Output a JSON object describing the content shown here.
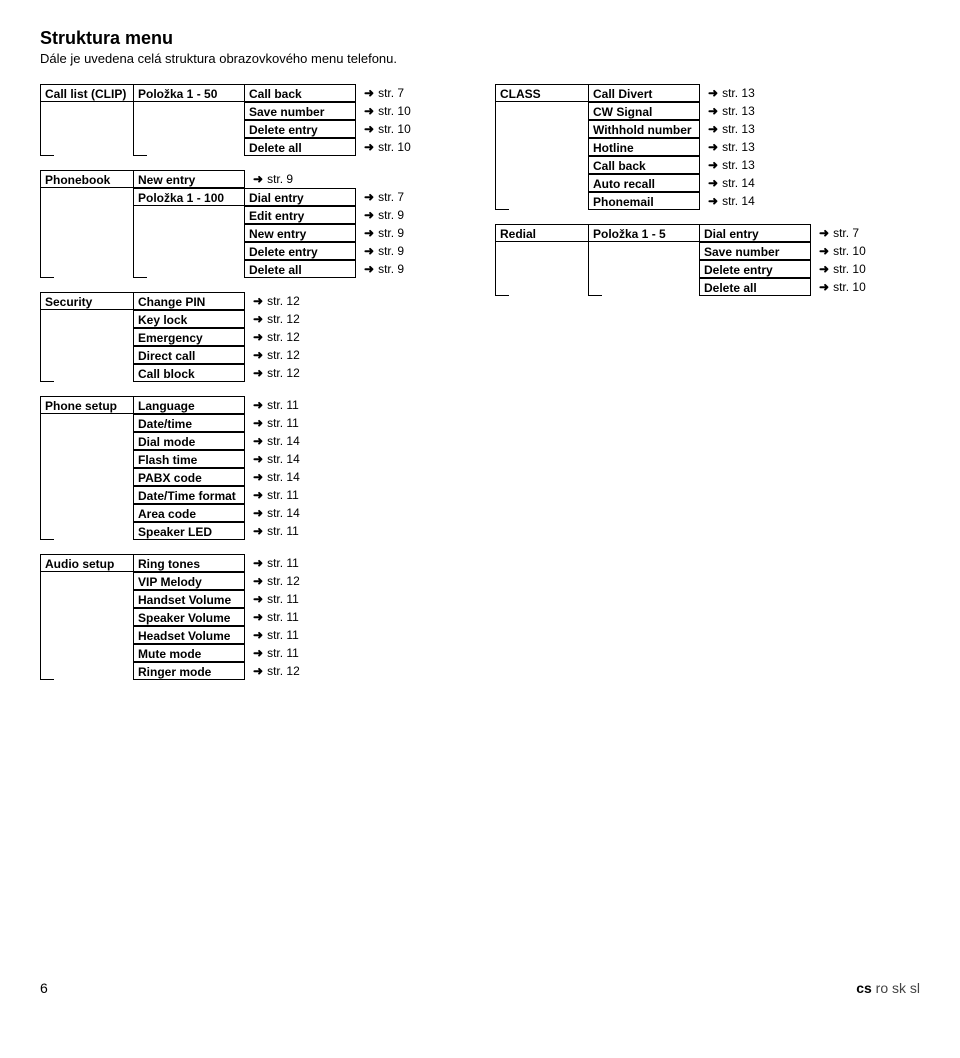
{
  "title": "Struktura menu",
  "intro": "Dále je uvedena celá struktura obrazovkového menu telefonu.",
  "arrow_glyph": "➜",
  "menu_left": [
    {
      "key": "calllist",
      "c0": "Call list (CLIP)",
      "rows": [
        {
          "c1": "Položka 1 - 50",
          "c2": "Call back",
          "ref": "str. 7"
        },
        {
          "c2": "Save number",
          "ref": "str. 10"
        },
        {
          "c2": "Delete entry",
          "ref": "str. 10"
        },
        {
          "c2": "Delete all",
          "ref": "str. 10"
        }
      ]
    },
    {
      "key": "phonebook",
      "c0": "Phonebook",
      "rows": [
        {
          "c1": "New entry",
          "ref": "str. 9"
        },
        {
          "c1": "Položka 1 - 100",
          "c2": "Dial entry",
          "ref": "str. 7"
        },
        {
          "c2": "Edit entry",
          "ref": "str. 9"
        },
        {
          "c2": "New entry",
          "ref": "str. 9"
        },
        {
          "c2": "Delete entry",
          "ref": "str. 9"
        },
        {
          "c2": "Delete all",
          "ref": "str. 9"
        }
      ]
    },
    {
      "key": "security",
      "c0": "Security",
      "rows": [
        {
          "c1": "Change PIN",
          "ref": "str. 12"
        },
        {
          "c1": "Key lock",
          "ref": "str. 12"
        },
        {
          "c1": "Emergency",
          "ref": "str. 12"
        },
        {
          "c1": "Direct call",
          "ref": "str. 12"
        },
        {
          "c1": "Call block",
          "ref": "str. 12"
        }
      ]
    },
    {
      "key": "phonesetup",
      "c0": "Phone setup",
      "rows": [
        {
          "c1": "Language",
          "ref": "str. 11"
        },
        {
          "c1": "Date/time",
          "ref": "str. 11"
        },
        {
          "c1": "Dial mode",
          "ref": "str. 14"
        },
        {
          "c1": "Flash time",
          "ref": "str. 14"
        },
        {
          "c1": "PABX code",
          "ref": "str. 14"
        },
        {
          "c1": "Date/Time format",
          "ref": "str. 11"
        },
        {
          "c1": "Area code",
          "ref": "str. 14"
        },
        {
          "c1": "Speaker LED",
          "ref": "str. 11"
        }
      ]
    },
    {
      "key": "audiosetup",
      "c0": "Audio setup",
      "rows": [
        {
          "c1": "Ring tones",
          "ref": "str. 11"
        },
        {
          "c1": "VIP Melody",
          "ref": "str. 12"
        },
        {
          "c1": "Handset Volume",
          "ref": "str. 11"
        },
        {
          "c1": "Speaker Volume",
          "ref": "str. 11"
        },
        {
          "c1": "Headset Volume",
          "ref": "str. 11"
        },
        {
          "c1": "Mute mode",
          "ref": "str. 11"
        },
        {
          "c1": "Ringer mode",
          "ref": "str. 12"
        }
      ]
    }
  ],
  "menu_right": [
    {
      "key": "class",
      "c0": "CLASS",
      "rows": [
        {
          "c1": "Call Divert",
          "ref": "str. 13"
        },
        {
          "c1": "CW Signal",
          "ref": "str. 13"
        },
        {
          "c1": "Withhold number",
          "ref": "str. 13"
        },
        {
          "c1": "Hotline",
          "ref": "str. 13"
        },
        {
          "c1": "Call back",
          "ref": "str. 13"
        },
        {
          "c1": "Auto recall",
          "ref": "str. 14"
        },
        {
          "c1": "Phonemail",
          "ref": "str. 14"
        }
      ]
    },
    {
      "key": "redial",
      "c0": "Redial",
      "rows": [
        {
          "c1": "Položka 1 - 5",
          "c2": "Dial entry",
          "ref": "str. 7"
        },
        {
          "c2": "Save number",
          "ref": "str. 10"
        },
        {
          "c2": "Delete entry",
          "ref": "str. 10"
        },
        {
          "c2": "Delete all",
          "ref": "str. 10"
        }
      ]
    }
  ],
  "footer": {
    "page": "6",
    "locale_bold": "cs",
    "locale_rest": " ro sk sl"
  }
}
